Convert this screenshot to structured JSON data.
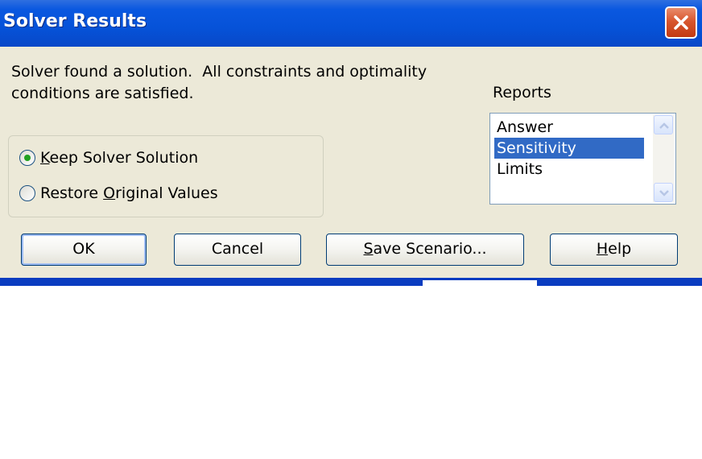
{
  "window": {
    "title": "Solver Results"
  },
  "message": {
    "line1": "Solver found a solution.  All constraints and optimality",
    "line2": "conditions are satisfied."
  },
  "reports": {
    "label": "Reports",
    "items": [
      {
        "label": "Answer",
        "selected": false
      },
      {
        "label": "Sensitivity",
        "selected": true
      },
      {
        "label": "Limits",
        "selected": false
      }
    ]
  },
  "options": {
    "keep": {
      "label_mnemonic": "K",
      "label_rest": "eep Solver Solution",
      "selected": true
    },
    "restore": {
      "label_pre": "Restore ",
      "label_mnemonic": "O",
      "label_rest": "riginal Values",
      "selected": false
    }
  },
  "buttons": {
    "ok": "OK",
    "cancel": "Cancel",
    "save_mnemonic": "S",
    "save_rest": "ave Scenario...",
    "help_mnemonic": "H",
    "help_rest": "elp"
  },
  "colors": {
    "title_bar": "#0652d8",
    "dialog_bg": "#ece9d8",
    "selection": "#316ac5",
    "close_button": "#d8562e",
    "radio_dot": "#21a121"
  },
  "icons": {
    "close": "close-icon",
    "scroll_up": "chevron-up-icon",
    "scroll_down": "chevron-down-icon"
  }
}
